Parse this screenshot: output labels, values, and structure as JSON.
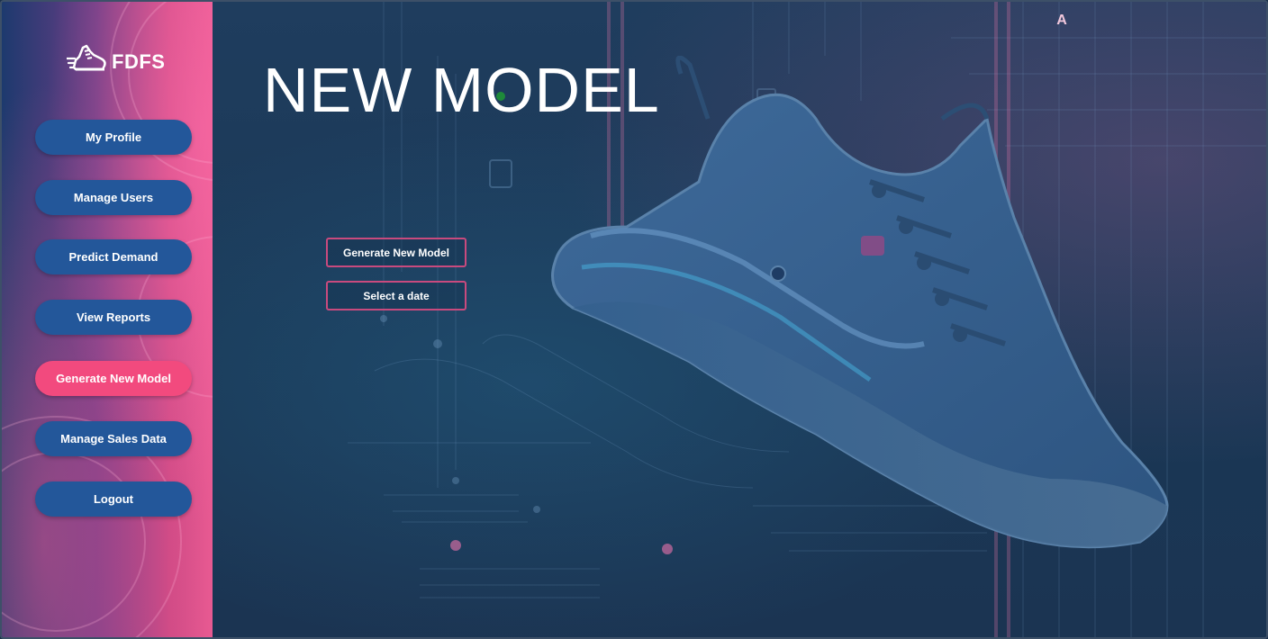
{
  "app": {
    "logo_text": "FDFS",
    "logo_icon": "running-shoe-icon"
  },
  "sidebar": {
    "items": [
      {
        "label": "My Profile",
        "active": false
      },
      {
        "label": "Manage Users",
        "active": false
      },
      {
        "label": "Predict Demand",
        "active": false
      },
      {
        "label": "View Reports",
        "active": false
      },
      {
        "label": "Generate New Model",
        "active": true
      },
      {
        "label": "Manage Sales Data",
        "active": false
      },
      {
        "label": "Logout",
        "active": false
      }
    ]
  },
  "header": {
    "avatar_initial": "A"
  },
  "main": {
    "title": "NEW MODEL",
    "generate_button_label": "Generate New Model",
    "date_button_label": "Select a date",
    "background_image": "futuristic-sneaker-circuit-illustration"
  },
  "colors": {
    "nav_button": "#23579a",
    "nav_active": "#f24a7e",
    "action_border": "#c94a7e",
    "main_background": "#1f3d5e"
  }
}
